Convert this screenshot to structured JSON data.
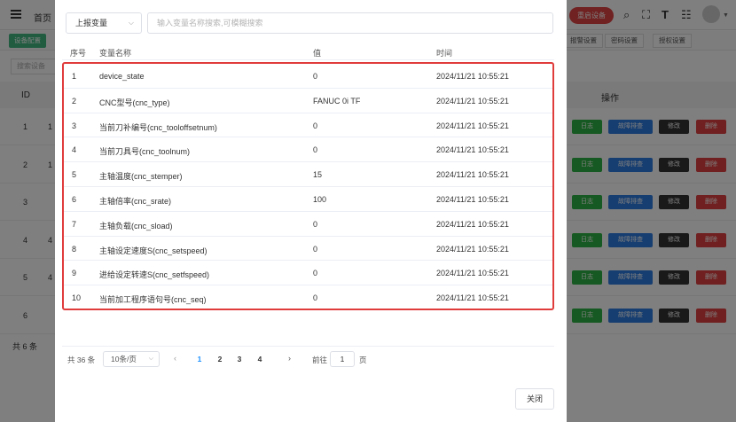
{
  "background": {
    "nav": {
      "home": "首页",
      "restart": "重启设备"
    },
    "tags": {
      "active": "设备配置",
      "items": [
        "报警设置",
        "密码设置",
        "授权设置"
      ]
    },
    "search_placeholder": "搜索设备",
    "table": {
      "id_header": "ID",
      "operation_header": "操作",
      "row_ids": [
        "1",
        "2",
        "3",
        "4",
        "5",
        "6"
      ],
      "row_sub": [
        "1",
        "1",
        "",
        "4",
        "4",
        ""
      ],
      "buttons": {
        "log": "日志",
        "fault": "故障排查",
        "edit": "修改",
        "delete": "删除"
      }
    },
    "total": "共 6 条"
  },
  "modal": {
    "type_select": "上报变量",
    "search_placeholder": "输入变量名称搜索,可模糊搜索",
    "headers": {
      "no": "序号",
      "name": "变量名称",
      "value": "值",
      "time": "时间"
    },
    "rows": [
      {
        "no": "1",
        "name": "device_state",
        "value": "0",
        "time": "2024/11/21 10:55:21"
      },
      {
        "no": "2",
        "name": "CNC型号(cnc_type)",
        "value": "FANUC 0i TF",
        "time": "2024/11/21 10:55:21"
      },
      {
        "no": "3",
        "name": "当前刀补编号(cnc_tooloffsetnum)",
        "value": "0",
        "time": "2024/11/21 10:55:21"
      },
      {
        "no": "4",
        "name": "当前刀具号(cnc_toolnum)",
        "value": "0",
        "time": "2024/11/21 10:55:21"
      },
      {
        "no": "5",
        "name": "主轴温度(cnc_stemper)",
        "value": "15",
        "time": "2024/11/21 10:55:21"
      },
      {
        "no": "6",
        "name": "主轴倍率(cnc_srate)",
        "value": "100",
        "time": "2024/11/21 10:55:21"
      },
      {
        "no": "7",
        "name": "主轴负载(cnc_sload)",
        "value": "0",
        "time": "2024/11/21 10:55:21"
      },
      {
        "no": "8",
        "name": "主轴设定速度S(cnc_setspeed)",
        "value": "0",
        "time": "2024/11/21 10:55:21"
      },
      {
        "no": "9",
        "name": "进给设定转速S(cnc_setfspeed)",
        "value": "0",
        "time": "2024/11/21 10:55:21"
      },
      {
        "no": "10",
        "name": "当前加工程序语句号(cnc_seq)",
        "value": "0",
        "time": "2024/11/21 10:55:21"
      }
    ],
    "pagination": {
      "total": "共 36 条",
      "page_size": "10条/页",
      "pages": [
        "1",
        "2",
        "3",
        "4"
      ],
      "current": "1",
      "goto_label": "前往",
      "goto_value": "1",
      "goto_suffix": "页"
    },
    "close": "关闭"
  },
  "colors": {
    "highlight_border": "#e03c3c",
    "active_page": "#1890ff",
    "overlay": "rgba(0,0,0,0.5)"
  }
}
